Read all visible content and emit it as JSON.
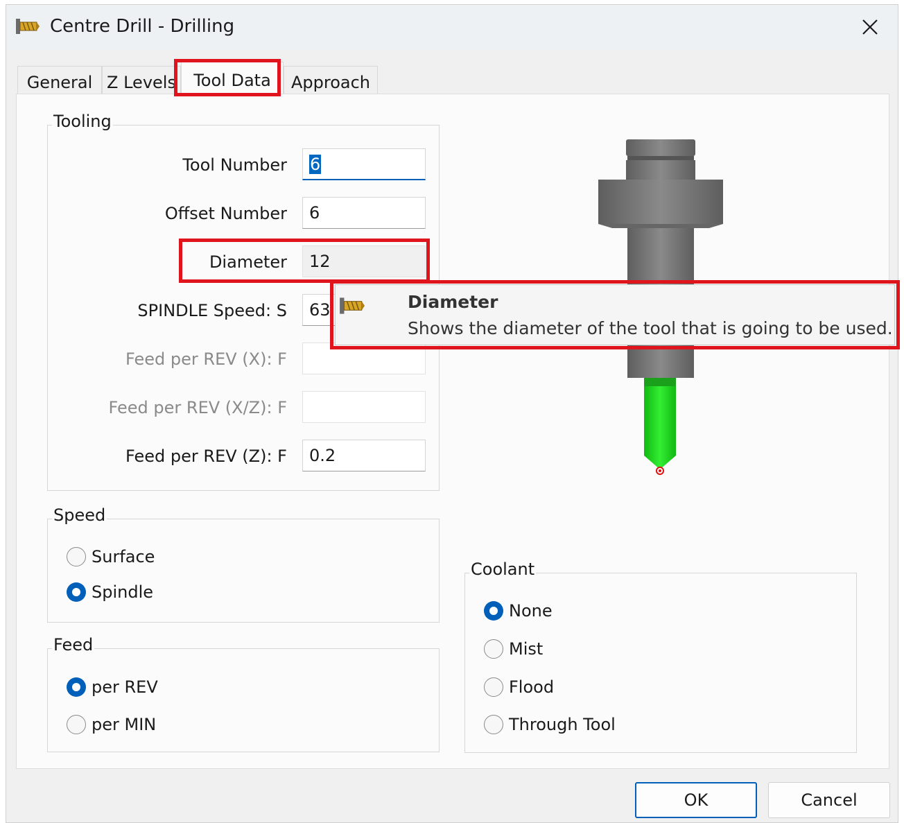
{
  "window": {
    "title": "Centre Drill - Drilling",
    "icon": "drill-tool-icon",
    "close_icon": "close-icon"
  },
  "tabs": [
    {
      "label": "General",
      "active": false
    },
    {
      "label": "Z Levels",
      "active": false
    },
    {
      "label": "Tool Data",
      "active": true
    },
    {
      "label": "Approach",
      "active": false
    }
  ],
  "tooling": {
    "title": "Tooling",
    "fields": [
      {
        "label": "Tool Number",
        "value": "6",
        "state": "focused"
      },
      {
        "label": "Offset Number",
        "value": "6",
        "state": "normal"
      },
      {
        "label": "Diameter",
        "value": "12",
        "state": "readonly"
      },
      {
        "label": "SPINDLE Speed: S",
        "value": "63",
        "state": "normal"
      },
      {
        "label": "Feed per REV (X): F",
        "value": "",
        "state": "disabled"
      },
      {
        "label": "Feed per REV (X/Z): F",
        "value": "",
        "state": "disabled"
      },
      {
        "label": "Feed per REV (Z): F",
        "value": "0.2",
        "state": "normal"
      }
    ]
  },
  "speed": {
    "title": "Speed",
    "options": [
      {
        "label": "Surface",
        "selected": false
      },
      {
        "label": "Spindle",
        "selected": true
      }
    ]
  },
  "feed": {
    "title": "Feed",
    "options": [
      {
        "label": "per REV",
        "selected": true
      },
      {
        "label": "per MIN",
        "selected": false
      }
    ]
  },
  "coolant": {
    "title": "Coolant",
    "options": [
      {
        "label": "None",
        "selected": true
      },
      {
        "label": "Mist",
        "selected": false
      },
      {
        "label": "Flood",
        "selected": false
      },
      {
        "label": "Through Tool",
        "selected": false
      }
    ]
  },
  "tooltip": {
    "title": "Diameter",
    "text": "Shows the diameter of the tool that is going to be used.",
    "icon": "drill-tool-icon"
  },
  "buttons": {
    "ok": "OK",
    "cancel": "Cancel"
  },
  "colors": {
    "highlight": "#e0141d",
    "accent": "#005fb8",
    "tool_body": "#7a7a7a",
    "tool_tip": "#22dd22"
  }
}
